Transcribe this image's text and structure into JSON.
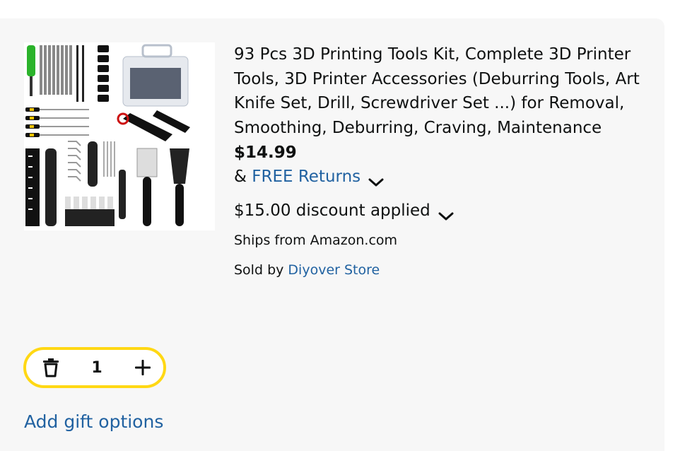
{
  "product": {
    "title": "93 Pcs 3D Printing Tools Kit, Complete 3D Printer Tools, 3D Printer Accessories (Deburring Tools, Art Knife Set, Drill, Screwdriver Set ...) for Removal, Smoothing, Deburring, Craving, Maintenance",
    "price": "$14.99",
    "returns_prefix": "& ",
    "returns_link": "FREE Returns",
    "discount": "$15.00 discount applied",
    "ships_from": "Ships from Amazon.com",
    "sold_by_prefix": "Sold by ",
    "sold_by_link": "Diyover Store"
  },
  "quantity": {
    "value": "1",
    "delete_icon": "trash-icon",
    "add_icon": "plus-icon"
  },
  "gift": {
    "label": "Add gift options"
  },
  "colors": {
    "card_bg": "#f7f7f7",
    "link": "#2162a1",
    "stepper_border": "#ffd814",
    "text": "#0f1111"
  }
}
